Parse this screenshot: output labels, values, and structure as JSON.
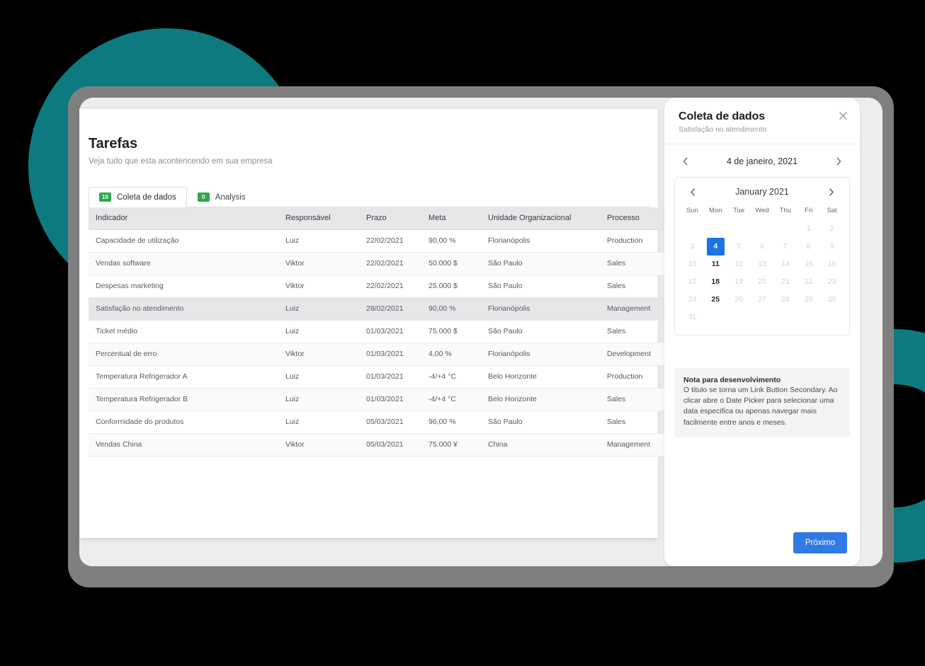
{
  "theme": {
    "teal": "#0d7a80",
    "frame_grey": "#7f7f7f",
    "badge_green": "#2fa84f",
    "primary_blue": "#2f7ae5",
    "today_blue": "#1a73e8"
  },
  "main": {
    "title": "Tarefas",
    "subtitle": "Veja tudo que esta acontencendo em sua empresa",
    "tabs": [
      {
        "badge": "10",
        "label": "Coleta de dados",
        "active": true
      },
      {
        "badge": "0",
        "label": "Analysis",
        "active": false
      }
    ],
    "table": {
      "columns": [
        "Indicador",
        "Responsável",
        "Prazo",
        "Meta",
        "Unidade Organizacional",
        "Processo"
      ],
      "rows": [
        {
          "indicador": "Capacidade de utilização",
          "responsavel": "Luiz",
          "prazo": "22/02/2021",
          "meta": "90,00 %",
          "unidade": "Florianópolis",
          "processo": "Production",
          "selected": false
        },
        {
          "indicador": "Vendas software",
          "responsavel": "Viktor",
          "prazo": "22/02/2021",
          "meta": "50.000 $",
          "unidade": "São Paulo",
          "processo": "Sales",
          "selected": false
        },
        {
          "indicador": "Despesas marketing",
          "responsavel": "Viktor",
          "prazo": "22/02/2021",
          "meta": "25.000 $",
          "unidade": "São Paulo",
          "processo": "Sales",
          "selected": false
        },
        {
          "indicador": "Satisfação no atendimento",
          "responsavel": "Luiz",
          "prazo": "28/02/2021",
          "meta": "90,00 %",
          "unidade": "Florianópolis",
          "processo": "Management",
          "selected": true
        },
        {
          "indicador": "Ticket médio",
          "responsavel": "Luiz",
          "prazo": "01/03/2021",
          "meta": "75.000 $",
          "unidade": "São Paulo",
          "processo": "Sales",
          "selected": false
        },
        {
          "indicador": "Percentual de erro",
          "responsavel": "Viktor",
          "prazo": "01/03/2021",
          "meta": "4,00 %",
          "unidade": "Florianópolis",
          "processo": "Development",
          "selected": false
        },
        {
          "indicador": "Temperatura Refrigerador A",
          "responsavel": "Luiz",
          "prazo": "01/03/2021",
          "meta": "-4/+4 °C",
          "unidade": "Belo Horizonte",
          "processo": "Production",
          "selected": false
        },
        {
          "indicador": "Temperatura Refrigerador B",
          "responsavel": "Luiz",
          "prazo": "01/03/2021",
          "meta": "-4/+4 °C",
          "unidade": "Belo Horizonte",
          "processo": "Sales",
          "selected": false
        },
        {
          "indicador": "Conformidade do produtos",
          "responsavel": "Luiz",
          "prazo": "05/03/2021",
          "meta": "96,00 %",
          "unidade": "São Paulo",
          "processo": "Sales",
          "selected": false
        },
        {
          "indicador": "Vendas China",
          "responsavel": "Viktor",
          "prazo": "05/03/2021",
          "meta": "75.000 ¥",
          "unidade": "China",
          "processo": "Management",
          "selected": false
        }
      ]
    }
  },
  "panel": {
    "title": "Coleta de dados",
    "subtitle": "Satisfação no atendimento",
    "close_icon": "close-icon",
    "date_nav": {
      "prev_icon": "chevron-left-icon",
      "next_icon": "chevron-right-icon",
      "label": "4 de janeiro, 2021"
    },
    "calendar": {
      "prev_icon": "chevron-left-icon",
      "next_icon": "chevron-right-icon",
      "month_label": "January 2021",
      "weekdays": [
        "Sun",
        "Mon",
        "Tue",
        "Wed",
        "Thu",
        "Fri",
        "Sat"
      ],
      "leading_blanks": 5,
      "days": [
        {
          "n": "1",
          "state": "disabled"
        },
        {
          "n": "2",
          "state": "disabled"
        },
        {
          "n": "3",
          "state": "disabled"
        },
        {
          "n": "4",
          "state": "today"
        },
        {
          "n": "5",
          "state": "disabled"
        },
        {
          "n": "6",
          "state": "disabled"
        },
        {
          "n": "7",
          "state": "disabled"
        },
        {
          "n": "8",
          "state": "disabled"
        },
        {
          "n": "9",
          "state": "disabled"
        },
        {
          "n": "10",
          "state": "disabled"
        },
        {
          "n": "11",
          "state": "enabled"
        },
        {
          "n": "12",
          "state": "disabled"
        },
        {
          "n": "13",
          "state": "disabled"
        },
        {
          "n": "14",
          "state": "disabled"
        },
        {
          "n": "15",
          "state": "disabled"
        },
        {
          "n": "16",
          "state": "disabled"
        },
        {
          "n": "17",
          "state": "disabled"
        },
        {
          "n": "18",
          "state": "enabled"
        },
        {
          "n": "19",
          "state": "disabled"
        },
        {
          "n": "20",
          "state": "disabled"
        },
        {
          "n": "21",
          "state": "disabled"
        },
        {
          "n": "22",
          "state": "disabled"
        },
        {
          "n": "23",
          "state": "disabled"
        },
        {
          "n": "24",
          "state": "disabled"
        },
        {
          "n": "25",
          "state": "enabled"
        },
        {
          "n": "26",
          "state": "disabled"
        },
        {
          "n": "27",
          "state": "disabled"
        },
        {
          "n": "28",
          "state": "disabled"
        },
        {
          "n": "29",
          "state": "disabled"
        },
        {
          "n": "30",
          "state": "disabled"
        },
        {
          "n": "31",
          "state": "disabled"
        }
      ]
    },
    "note": {
      "title": "Nota para desenvolvimento",
      "body": "O titulo se torna um Link Button Secondary. Ao clicar abre o Date Picker para selecionar uma data especifica ou apenas navegar mais facilmente entre anos e meses."
    },
    "footer": {
      "next_label": "Próximo"
    }
  }
}
